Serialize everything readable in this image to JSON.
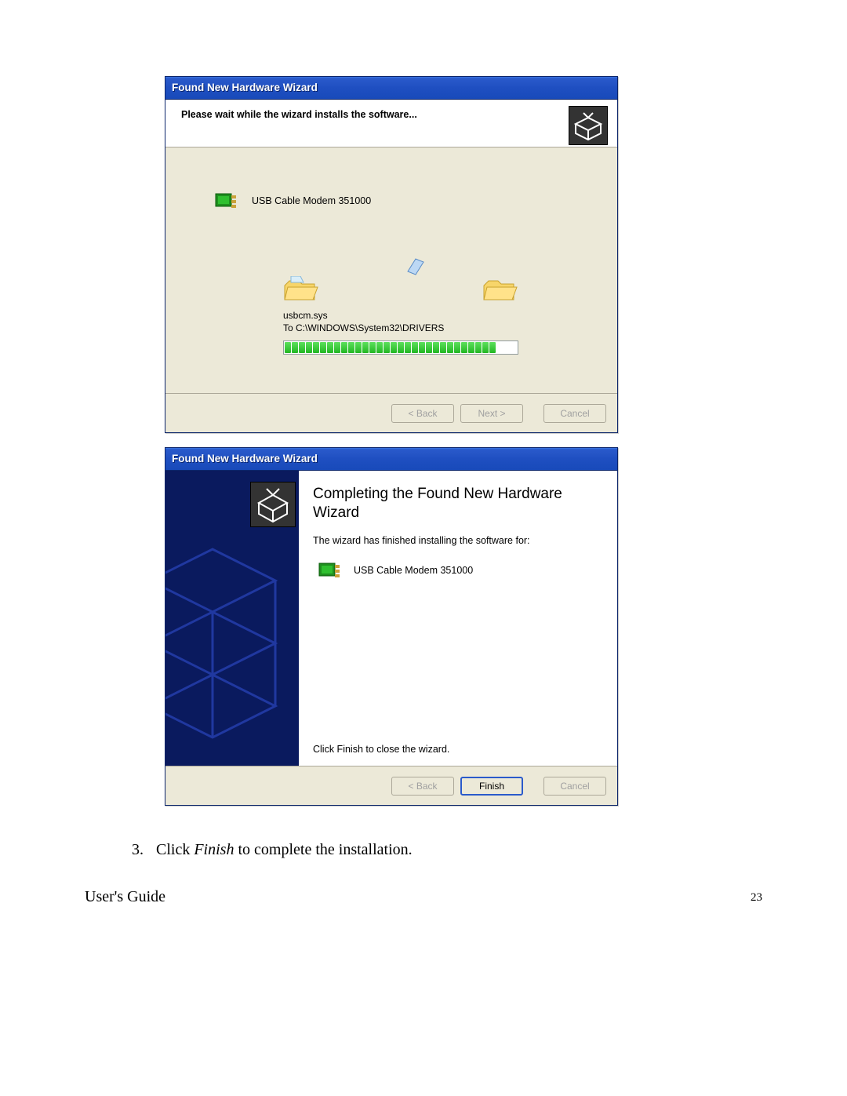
{
  "dialog1": {
    "title": "Found New Hardware Wizard",
    "header": "Please wait while the wizard installs the software...",
    "device_name": "USB Cable Modem 351000",
    "copy_file": "usbcm.sys",
    "copy_dest": "To C:\\WINDOWS\\System32\\DRIVERS",
    "buttons": {
      "back": "< Back",
      "next": "Next >",
      "cancel": "Cancel"
    },
    "progress_segments": 30
  },
  "dialog2": {
    "title": "Found New Hardware Wizard",
    "heading": "Completing the Found New Hardware Wizard",
    "sub": "The wizard has finished installing the software for:",
    "device_name": "USB Cable Modem 351000",
    "finish_hint": "Click Finish to close the wizard.",
    "buttons": {
      "back": "< Back",
      "finish": "Finish",
      "cancel": "Cancel"
    }
  },
  "instruction": {
    "number": "3.",
    "pre": "Click ",
    "em": "Finish",
    "post": " to complete the installation."
  },
  "footer": {
    "left": "User's Guide",
    "page": "23"
  }
}
